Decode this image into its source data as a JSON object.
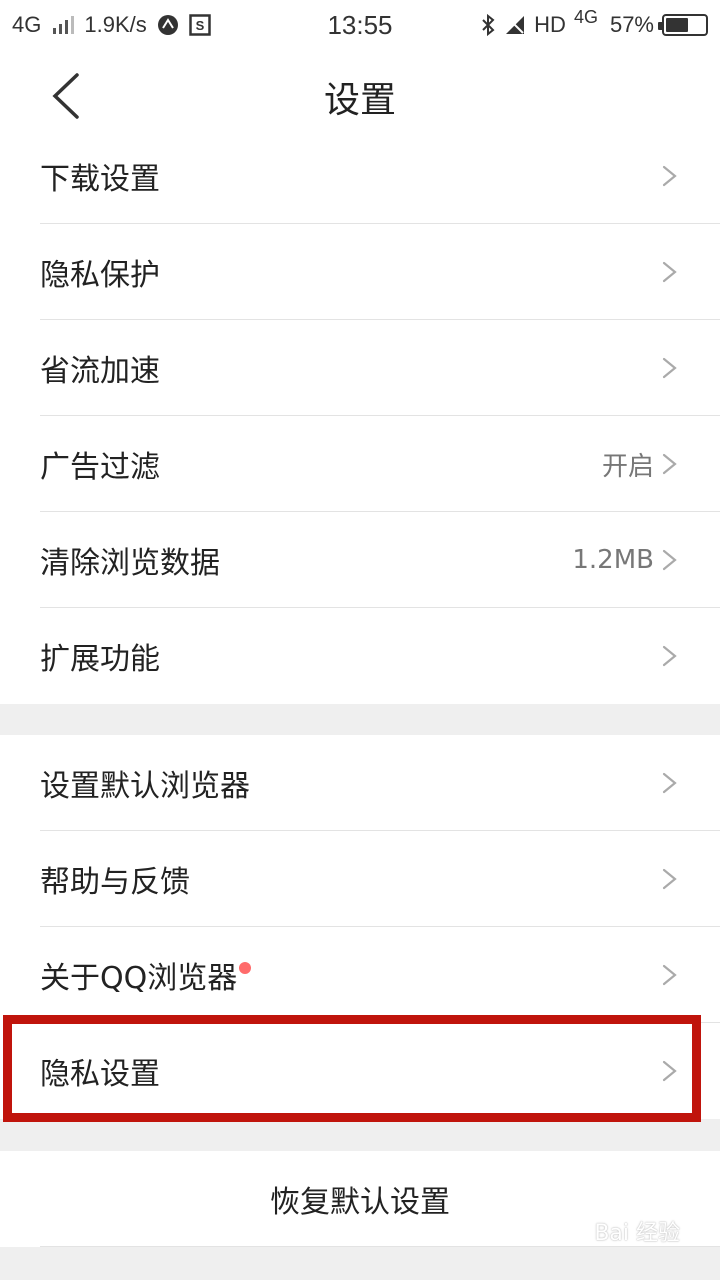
{
  "statusbar": {
    "network": "4G",
    "speed": "1.9K/s",
    "time": "13:55",
    "hd": "HD",
    "network2": "4G",
    "battery": "57%",
    "battery_level": 0.57
  },
  "header": {
    "title": "设置"
  },
  "group1": [
    {
      "label": "下载设置",
      "value": ""
    },
    {
      "label": "隐私保护",
      "value": ""
    },
    {
      "label": "省流加速",
      "value": ""
    },
    {
      "label": "广告过滤",
      "value": "开启"
    },
    {
      "label": "清除浏览数据",
      "value": "1.2MB"
    },
    {
      "label": "扩展功能",
      "value": ""
    }
  ],
  "group2": [
    {
      "label": "设置默认浏览器",
      "value": ""
    },
    {
      "label": "帮助与反馈",
      "value": ""
    },
    {
      "label": "关于QQ浏览器",
      "value": ""
    },
    {
      "label": "隐私设置",
      "value": ""
    }
  ],
  "restore_label": "恢复默认设置",
  "watermark": "Bai 经验"
}
